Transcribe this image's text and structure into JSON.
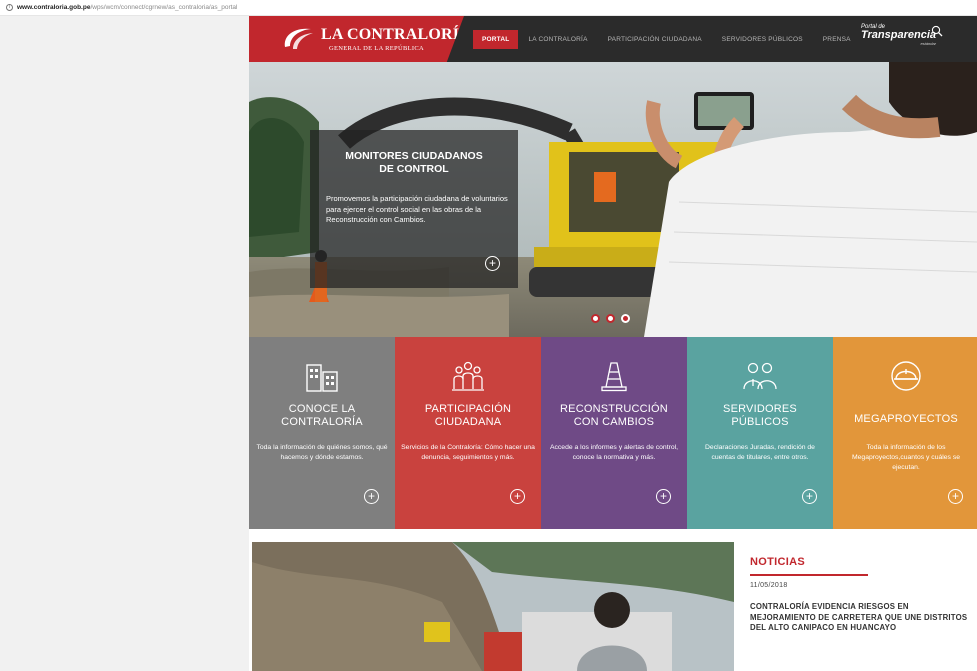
{
  "browser": {
    "url_host": "www.contraloria.gob.pe",
    "url_path": "/wps/wcm/connect/cgrnew/as_contraloria/as_portal"
  },
  "header": {
    "logo_title": "LA CONTRALORÍA",
    "logo_subtitle": "GENERAL DE LA REPÚBLICA",
    "nav": [
      {
        "label": "PORTAL",
        "active": true
      },
      {
        "label": "LA CONTRALORÍA",
        "active": false
      },
      {
        "label": "PARTICIPACIÓN CIUDADANA",
        "active": false
      },
      {
        "label": "SERVIDORES PÚBLICOS",
        "active": false
      },
      {
        "label": "PRENSA",
        "active": false
      }
    ],
    "transparency_line1": "Portal de",
    "transparency_line2": "Transparencia",
    "transparency_line3": "estándar"
  },
  "hero": {
    "title": "MONITORES CIUDADANOS\nDE CONTROL",
    "body": "Promovemos la participación ciudadana de voluntarios para ejercer el control social en las obras de la Reconstrucción con Cambios.",
    "more_symbol": "+",
    "slides": 3,
    "active_slide": 3
  },
  "tiles": [
    {
      "title": "CONOCE LA\nCONTRALORÍA",
      "desc": "Toda la información de quiénes somos, qué hacemos y dónde estamos.",
      "color": "#7f7f7f",
      "icon": "buildings-icon"
    },
    {
      "title": "PARTICIPACIÓN\nCIUDADANA",
      "desc": "Servicios de la Contraloría: Cómo hacer una denuncia, seguimientos y más.",
      "color": "#c9423e",
      "icon": "citizens-group-icon"
    },
    {
      "title": "RECONSTRUCCIÓN\nCON CAMBIOS",
      "desc": "Accede a los informes y alertas de control, conoce la normativa y más.",
      "color": "#6f4a86",
      "icon": "traffic-cone-icon"
    },
    {
      "title": "SERVIDORES\nPÚBLICOS",
      "desc": "Declaraciones Juradas, rendición de cuentas de titulares, entre otros.",
      "color": "#5aa3a0",
      "icon": "public-servants-icon"
    },
    {
      "title": "MEGAPROYECTOS",
      "desc": "Toda la información de los Megaproyectos,cuantos y cuáles se ejecutan.",
      "color": "#e2963a",
      "icon": "hardhat-icon"
    }
  ],
  "news": {
    "heading": "NOTICIAS",
    "date": "11/05/2018",
    "title": "CONTRALORÍA EVIDENCIA RIESGOS EN MEJORAMIENTO DE CARRETERA QUE UNE DISTRITOS DEL ALTO CANIPACO EN HUANCAYO"
  },
  "colors": {
    "brand_red": "#c1272d",
    "header_dark": "#2b2b2b"
  }
}
